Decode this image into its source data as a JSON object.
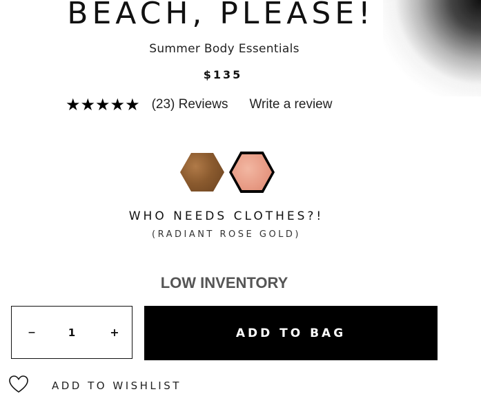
{
  "product": {
    "title": "BEACH, PLEASE!",
    "subtitle": "Summer Body Essentials",
    "price": "$135"
  },
  "rating": {
    "stars": "★★★★★",
    "stars_value": 5,
    "reviews_label": "(23) Reviews",
    "write_review_label": "Write a review"
  },
  "shades": {
    "selected_name": "WHO NEEDS CLOTHES?!",
    "selected_description": "(RADIANT ROSE GOLD)",
    "swatches": [
      {
        "color": "#8a5a2e",
        "selected": false
      },
      {
        "color": "#e79a84",
        "selected": true
      }
    ]
  },
  "inventory": {
    "status": "LOW INVENTORY"
  },
  "quantity": {
    "minus": "–",
    "value": "1",
    "plus": "+"
  },
  "cart": {
    "add_label": "ADD TO BAG"
  },
  "wishlist": {
    "label": "ADD TO WISHLIST"
  }
}
